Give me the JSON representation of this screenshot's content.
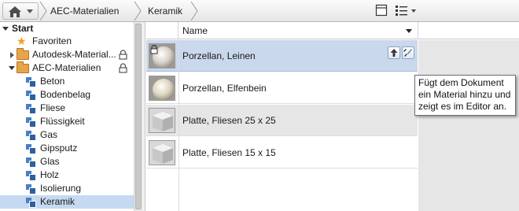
{
  "breadcrumb": {
    "items": [
      "AEC-Materialien",
      "Keramik"
    ]
  },
  "tree": {
    "root_label": "Start",
    "items": [
      {
        "label": "Favoriten",
        "type": "star"
      },
      {
        "label": "Autodesk-Material...",
        "type": "folder",
        "locked": true,
        "collapsed": true
      },
      {
        "label": "AEC-Materialien",
        "type": "folder",
        "locked": true,
        "collapsed": false
      },
      {
        "label": "Beton",
        "type": "category"
      },
      {
        "label": "Bodenbelag",
        "type": "category"
      },
      {
        "label": "Fliese",
        "type": "category"
      },
      {
        "label": "Flüssigkeit",
        "type": "category"
      },
      {
        "label": "Gas",
        "type": "category"
      },
      {
        "label": "Gipsputz",
        "type": "category"
      },
      {
        "label": "Glas",
        "type": "category"
      },
      {
        "label": "Holz",
        "type": "category"
      },
      {
        "label": "Isolierung",
        "type": "category"
      },
      {
        "label": "Keramik",
        "type": "category",
        "selected": true
      }
    ]
  },
  "list": {
    "column_header": "Name",
    "rows": [
      {
        "label": "Porzellan, Leinen",
        "swatch": "sphere-linen",
        "hover": true,
        "locked": true
      },
      {
        "label": "Porzellan, Elfenbein",
        "swatch": "sphere-ivory"
      },
      {
        "label": "Platte, Fliesen 25 x 25",
        "swatch": "cube-gray"
      },
      {
        "label": "Platte, Fliesen 15 x 15",
        "swatch": "cube-gray"
      }
    ]
  },
  "tooltip": {
    "line1": "Fügt dem Dokument",
    "line2": "ein Material hinzu und",
    "line3": "zeigt es im Editor an."
  },
  "colors": {
    "selection": "#c5d9f1",
    "hover_row": "#c9d8ec",
    "folder": "#e8a44a",
    "category_icon": "#2f5f9e"
  }
}
